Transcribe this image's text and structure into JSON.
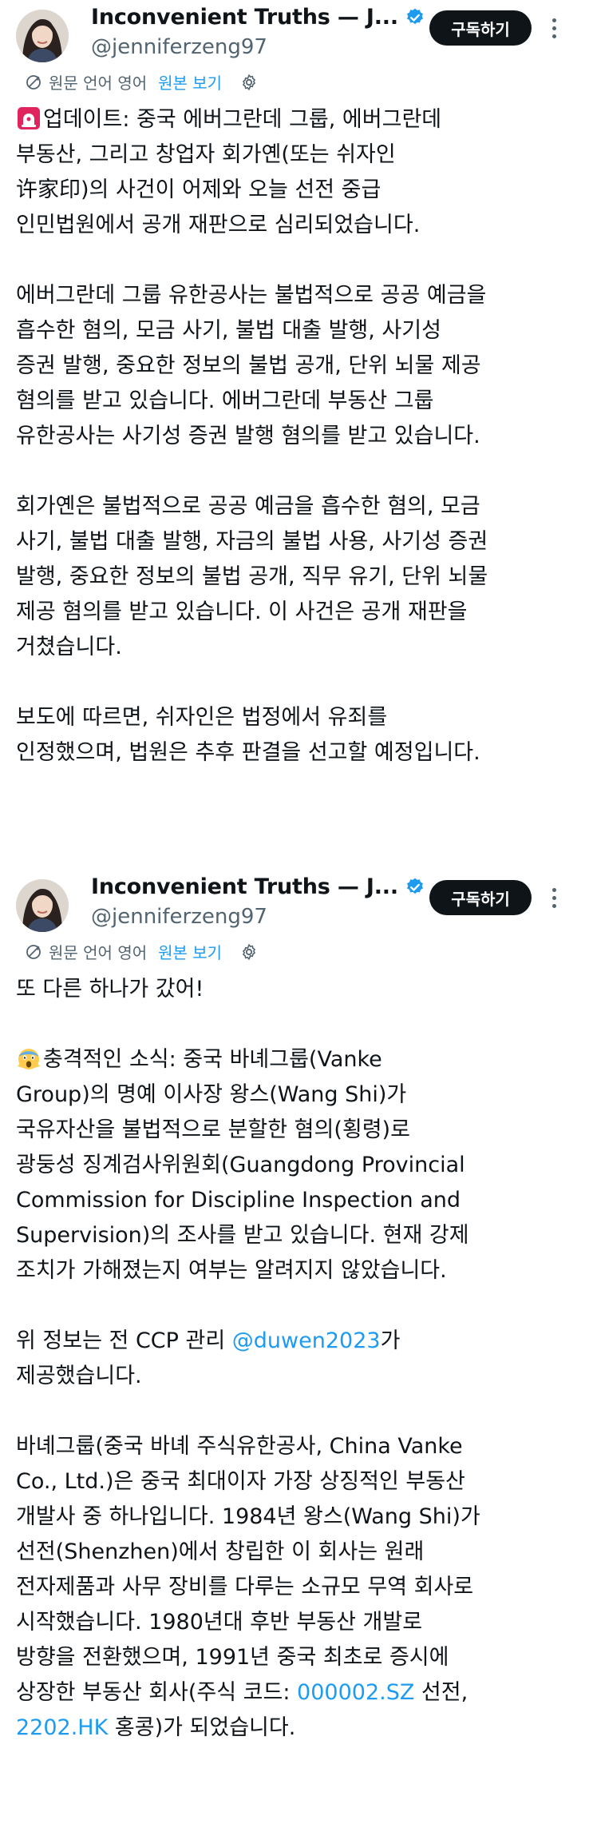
{
  "colors": {
    "text": "#0f1419",
    "secondary": "#536471",
    "accent": "#1d9bf0",
    "button_bg": "#0f1419",
    "button_text": "#ffffff",
    "verified_badge": "#1d9bf0"
  },
  "posts": [
    {
      "author": {
        "display_name": "Inconvenient Truths — J...",
        "handle": "@jenniferzeng97",
        "verified_icon": "verified-badge-icon",
        "avatar": "avatar-photo"
      },
      "subscribe_label": "구독하기",
      "more_icon": "more-options-icon",
      "translation": {
        "icon": "translate-icon",
        "text": "원문 언어 영어",
        "link": "원본 보기",
        "settings_icon": "gear-icon"
      },
      "body": {
        "emoji": "rotating-light-icon",
        "lines": [
          "업데이트: 중국 에버그란데 그룹, 에버그란데",
          "부동산, 그리고 창업자 회가옌(또는 쉬자인",
          "许家印)의 사건이 어제와 오늘 선전 중급",
          "인민법원에서 공개 재판으로 심리되었습니다.",
          "",
          "에버그란데 그룹 유한공사는 불법적으로 공공 예금을",
          "흡수한 혐의, 모금 사기, 불법 대출 발행, 사기성",
          "증권 발행, 중요한 정보의 불법 공개, 단위 뇌물 제공",
          "혐의를 받고 있습니다. 에버그란데 부동산 그룹",
          "유한공사는 사기성 증권 발행 혐의를 받고 있습니다.",
          "",
          "회가옌은 불법적으로 공공 예금을 흡수한 혐의, 모금",
          "사기, 불법 대출 발행, 자금의 불법 사용, 사기성 증권",
          "발행, 중요한 정보의 불법 공개, 직무 유기, 단위 뇌물",
          "제공 혐의를 받고 있습니다. 이 사건은 공개 재판을",
          "거쳤습니다.",
          "",
          "보도에 따르면, 쉬자인은 법정에서 유죄를",
          "인정했으며, 법원은 추후 판결을 선고할 예정입니다."
        ]
      }
    },
    {
      "author": {
        "display_name": "Inconvenient Truths — J...",
        "handle": "@jenniferzeng97",
        "verified_icon": "verified-badge-icon",
        "avatar": "avatar-photo"
      },
      "subscribe_label": "구독하기",
      "more_icon": "more-options-icon",
      "translation": {
        "icon": "translate-icon",
        "text": "원문 언어 영어",
        "link": "원본 보기",
        "settings_icon": "gear-icon"
      },
      "body": {
        "intro": "또 다른 하나가 갔어!",
        "emoji": "screaming-face-icon",
        "para1_lines": [
          "충격적인 소식: 중국 바녜그룹(Vanke",
          "Group)의 명예 이사장 왕스(Wang Shi)가",
          "국유자산을 불법적으로 분할한 혐의(횡령)로",
          "광둥성 징계검사위원회(Guangdong Provincial",
          "Commission for Discipline Inspection and",
          "Supervision)의 조사를 받고 있습니다. 현재 강제",
          "조치가 가해졌는지 여부는 알려지지 않았습니다."
        ],
        "para2_prefix": "위 정보는 전 CCP 관리 ",
        "para2_mention": "@duwen2023",
        "para2_suffix": "가",
        "para2_line2": "제공했습니다.",
        "para3_lines": [
          "바녜그룹(중국 바녜 주식유한공사, China Vanke",
          "Co., Ltd.)은 중국 최대이자 가장 상징적인 부동산",
          "개발사 중 하나입니다. 1984년 왕스(Wang Shi)가",
          "선전(Shenzhen)에서 창립한 이 회사는 원래",
          "전자제품과 사무 장비를 다루는 소규모 무역 회사로",
          "시작했습니다. 1980년대 후반 부동산 개발로",
          "방향을 전환했으며, 1991년 중국 최초로 증시에"
        ],
        "para3_line8_prefix": "상장한 부동산 회사(주식 코드: ",
        "para3_line8_cashtag": "000002.SZ",
        "para3_line8_suffix": " 선전,",
        "para3_line9_cashtag": "2202.HK",
        "para3_line9_suffix": " 홍콩)가 되었습니다."
      }
    }
  ]
}
